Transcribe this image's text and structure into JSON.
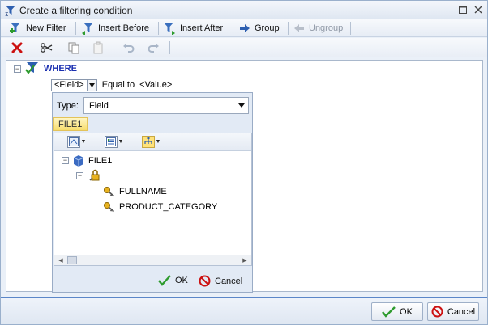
{
  "window": {
    "title": "Create a filtering condition"
  },
  "toolbar": {
    "new_filter": "New Filter",
    "insert_before": "Insert Before",
    "insert_after": "Insert After",
    "group": "Group",
    "ungroup": "Ungroup"
  },
  "condition": {
    "root_label": "WHERE",
    "field": "<Field>",
    "operator": "Equal to",
    "value": "<Value>"
  },
  "popup": {
    "type_label": "Type:",
    "type_value": "Field",
    "source_tab": "FILE1",
    "tree": {
      "root": "FILE1",
      "items": [
        "FULLNAME",
        "PRODUCT_CATEGORY"
      ]
    },
    "ok_label": "OK",
    "cancel_label": "Cancel"
  },
  "footer": {
    "ok_label": "OK",
    "cancel_label": "Cancel"
  },
  "colors": {
    "accent": "#5b86c8",
    "where_text": "#1a2fb0",
    "tab_highlight": "#f7dc6b",
    "delete_red": "#cc1111",
    "check_green": "#2e9b2e"
  }
}
